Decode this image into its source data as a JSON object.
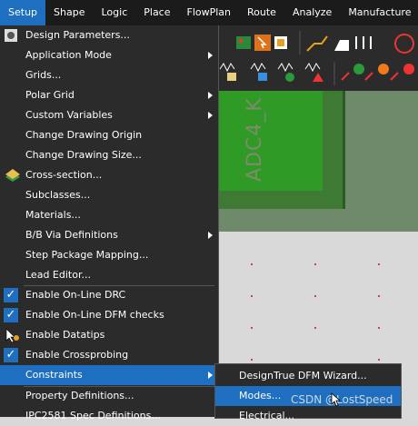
{
  "menubar": {
    "items": [
      "Setup",
      "Shape",
      "Logic",
      "Place",
      "FlowPlan",
      "Route",
      "Analyze",
      "Manufacture"
    ],
    "active_index": 0
  },
  "canvas": {
    "refdes": "ADC4_K",
    "colors": {
      "pad": "#2f9a25",
      "board": "#6f8a6a",
      "background": "#d9d9d9",
      "accent": "#1e6fbf"
    }
  },
  "setup_menu": {
    "items": [
      {
        "label": "Design Parameters...",
        "icon": "parameters-icon",
        "submenu": false,
        "checked": false
      },
      {
        "label": "Application Mode",
        "submenu": true,
        "checked": false
      },
      {
        "label": "Grids...",
        "submenu": false,
        "checked": false
      },
      {
        "label": "Polar Grid",
        "submenu": true,
        "checked": false
      },
      {
        "label": "Custom Variables",
        "submenu": true,
        "checked": false
      },
      {
        "label": "Change Drawing Origin",
        "submenu": false,
        "checked": false
      },
      {
        "label": "Change Drawing Size...",
        "submenu": false,
        "checked": false
      },
      {
        "label": "Cross-section...",
        "icon": "cross-section-icon",
        "submenu": false,
        "checked": false
      },
      {
        "label": "Subclasses...",
        "submenu": false,
        "checked": false
      },
      {
        "label": "Materials...",
        "submenu": false,
        "checked": false
      },
      {
        "label": "B/B Via Definitions",
        "submenu": true,
        "checked": false
      },
      {
        "label": "Step Package Mapping...",
        "submenu": false,
        "checked": false
      },
      {
        "label": "Lead Editor...",
        "submenu": false,
        "checked": false
      },
      {
        "label": "Enable On-Line DRC",
        "submenu": false,
        "checked": true
      },
      {
        "label": "Enable On-Line DFM checks",
        "submenu": false,
        "checked": true
      },
      {
        "label": "Enable Datatips",
        "submenu": false,
        "checked": false,
        "icon": "datatips-icon"
      },
      {
        "label": "Enable Crossprobing",
        "submenu": false,
        "checked": true
      },
      {
        "label": "Constraints",
        "submenu": true,
        "checked": false,
        "highlighted": true
      },
      {
        "label": "Property Definitions...",
        "submenu": false,
        "checked": false
      },
      {
        "label": "IPC2581 Spec Definitions...",
        "submenu": false,
        "checked": false
      }
    ]
  },
  "constraints_submenu": {
    "items": [
      {
        "label": "DesignTrue DFM Wizard...",
        "highlighted": false
      },
      {
        "label": "Modes...",
        "highlighted": true
      },
      {
        "label": "Electrical...",
        "highlighted": false
      }
    ]
  },
  "watermark": "CSDN @LostSpeed"
}
